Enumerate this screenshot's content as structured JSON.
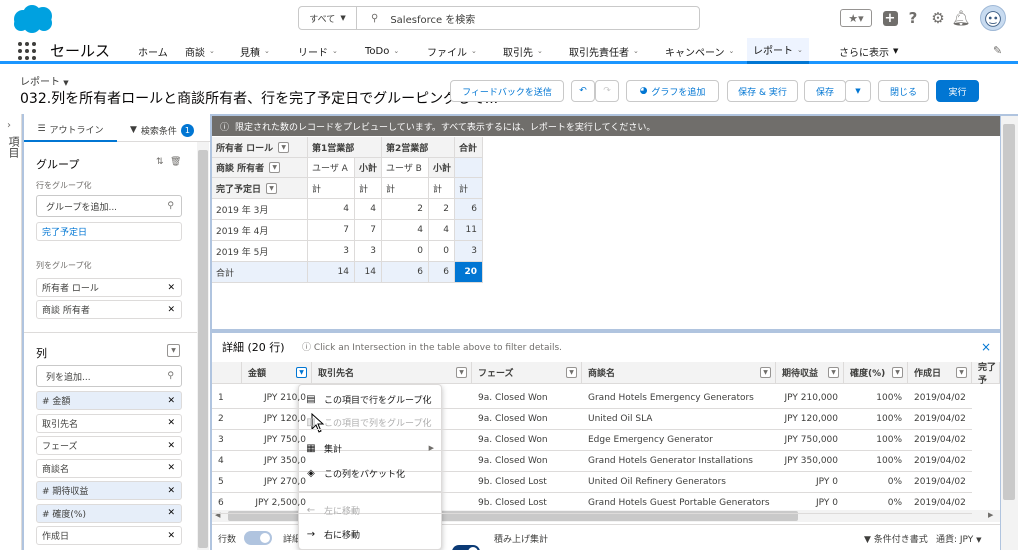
{
  "header": {
    "search_scope": "すべて",
    "search_placeholder": "Salesforce を検索",
    "app_name": "セールス"
  },
  "nav": [
    {
      "label": "ホーム",
      "dd": false
    },
    {
      "label": "商談",
      "dd": true
    },
    {
      "label": "見積",
      "dd": true
    },
    {
      "label": "リード",
      "dd": true
    },
    {
      "label": "ToDo",
      "dd": true
    },
    {
      "label": "ファイル",
      "dd": true
    },
    {
      "label": "取引先",
      "dd": true
    },
    {
      "label": "取引先責任者",
      "dd": true
    },
    {
      "label": "キャンペーン",
      "dd": true
    },
    {
      "label": "レポート",
      "dd": true
    },
    {
      "label": "さらに表示",
      "dd": true
    }
  ],
  "report": {
    "breadcrumb": "レポート",
    "title": "032.列を所有者ロールと商談所有者、行を完了予定日でグルーピングして..."
  },
  "buttons": {
    "feedback": "フィードバックを送信",
    "add_chart": "グラフを追加",
    "save_run": "保存 & 実行",
    "save": "保存",
    "close": "閉じる",
    "run": "実行"
  },
  "left_tab": "項目",
  "panel": {
    "tab_outline": "アウトライン",
    "tab_filters": "検索条件",
    "filter_count": "1",
    "groups_title": "グループ",
    "group_rows_label": "行をグループ化",
    "group_rows_placeholder": "グループを追加...",
    "row_groups": [
      "完了予定日"
    ],
    "group_cols_label": "列をグループ化",
    "col_groups": [
      "所有者 ロール",
      "商談 所有者"
    ],
    "columns_title": "列",
    "columns_placeholder": "列を追加...",
    "columns": [
      {
        "label": "# 金額",
        "num": true
      },
      {
        "label": "取引先名",
        "num": false
      },
      {
        "label": "フェーズ",
        "num": false
      },
      {
        "label": "商談名",
        "num": false
      },
      {
        "label": "# 期待収益",
        "num": true
      },
      {
        "label": "# 確度(%)",
        "num": true
      },
      {
        "label": "作成日",
        "num": false
      }
    ]
  },
  "preview": {
    "banner": "限定された数のレコードをプレビューしています。すべて表示するには、レポートを実行してください。",
    "h_role": "所有者 ロール",
    "h_owner": "商談 所有者",
    "h_date": "完了予定日",
    "dept1": "第1営業部",
    "dept2": "第2営業部",
    "total_label": "合計",
    "userA": "ユーザ A",
    "userB": "ユーザ B",
    "subtotal": "小計",
    "count": "計",
    "rows": [
      {
        "label": "2019 年 3月",
        "a": "4",
        "a_sub": "4",
        "b": "2",
        "b_sub": "2",
        "tot": "6"
      },
      {
        "label": "2019 年 4月",
        "a": "7",
        "a_sub": "7",
        "b": "4",
        "b_sub": "4",
        "tot": "11"
      },
      {
        "label": "2019 年 5月",
        "a": "3",
        "a_sub": "3",
        "b": "0",
        "b_sub": "0",
        "tot": "3"
      }
    ],
    "total_row": {
      "label": "合計",
      "a": "14",
      "a_sub": "14",
      "b": "6",
      "b_sub": "6",
      "tot": "20"
    }
  },
  "detail": {
    "title": "詳細 (20 行)",
    "hint": "Click an Intersection in the table above to filter details.",
    "columns": [
      "金額",
      "取引先名",
      "フェーズ",
      "商談名",
      "期待収益",
      "確度(%)",
      "作成日",
      "完了予"
    ],
    "rows": [
      {
        "n": "1",
        "amount": "JPY 210,0",
        "phase": "9a. Closed Won",
        "opp": "Grand Hotels Emergency Generators",
        "exp": "JPY 210,000",
        "prob": "100%",
        "created": "2019/04/02"
      },
      {
        "n": "2",
        "amount": "JPY 120,0",
        "phase": "9a. Closed Won",
        "opp": "United Oil SLA",
        "exp": "JPY 120,000",
        "prob": "100%",
        "created": "2019/04/02"
      },
      {
        "n": "3",
        "amount": "JPY 750,0",
        "phase": "9a. Closed Won",
        "opp": "Edge Emergency Generator",
        "exp": "JPY 750,000",
        "prob": "100%",
        "created": "2019/04/02"
      },
      {
        "n": "4",
        "amount": "JPY 350,0",
        "phase": "9a. Closed Won",
        "opp": "Grand Hotels Generator Installations",
        "exp": "JPY 350,000",
        "prob": "100%",
        "created": "2019/04/02"
      },
      {
        "n": "5",
        "amount": "JPY 270,0",
        "phase": "9b. Closed Lost",
        "opp": "United Oil Refinery Generators",
        "exp": "JPY 0",
        "prob": "0%",
        "created": "2019/04/02"
      },
      {
        "n": "6",
        "amount": "JPY 2,500,0",
        "phase": "9b. Closed Lost",
        "opp": "Grand Hotels Guest Portable Generators",
        "exp": "JPY 0",
        "prob": "0%",
        "created": "2019/04/02"
      }
    ]
  },
  "footer": {
    "row_count": "行数",
    "detail": "詳細",
    "stacked_summary": "積み上げ集計",
    "conditional": "条件付き書式",
    "currency": "通貨: JPY"
  },
  "menu": [
    {
      "label": "この項目で行をグループ化",
      "disabled": false,
      "icon": "▤"
    },
    {
      "label": "この項目で列をグループ化",
      "disabled": true,
      "icon": "▥"
    },
    {
      "label": "集計",
      "disabled": false,
      "icon": "▦",
      "sub": true
    },
    {
      "label": "この列をバケット化",
      "disabled": false,
      "icon": "◈"
    },
    {
      "label": "左に移動",
      "disabled": true,
      "icon": "←"
    },
    {
      "label": "右に移動",
      "disabled": false,
      "icon": "→"
    }
  ],
  "colors": {
    "brand": "#0176d3",
    "banner": "#706e6b",
    "cloud": "#00a1e0"
  }
}
